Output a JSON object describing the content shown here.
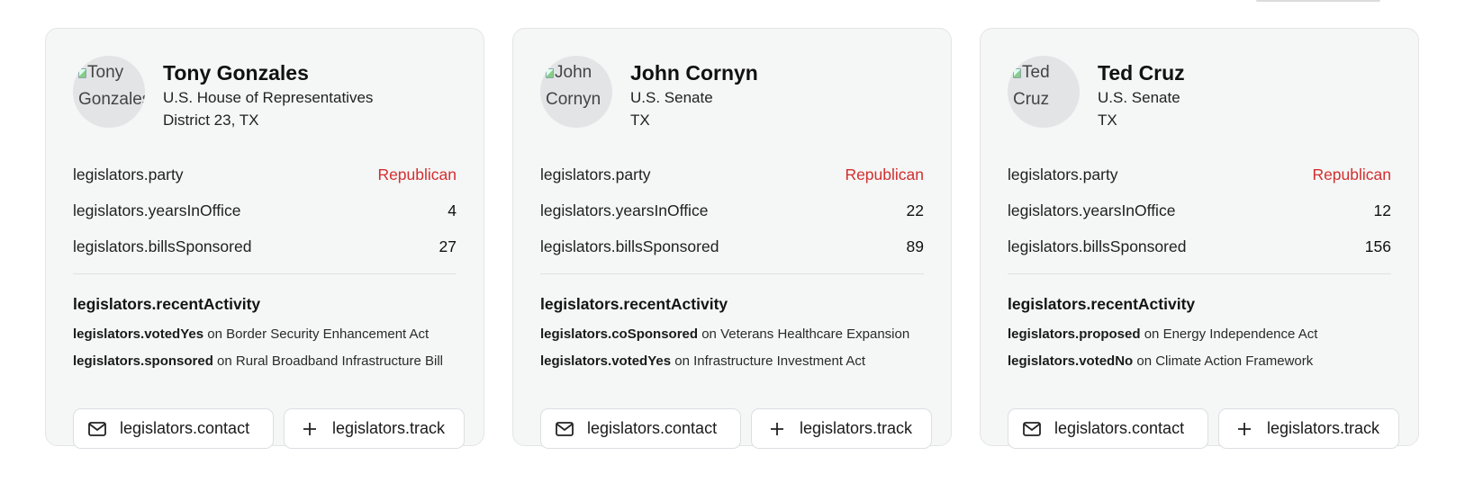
{
  "legislators": [
    {
      "avatar_alt": "Tony\nGonzales",
      "name": "Tony Gonzales",
      "chamber": "U.S. House of Representatives",
      "district": "District 23, TX",
      "stats": [
        {
          "label": "legislators.party",
          "value": "Republican"
        },
        {
          "label": "legislators.yearsInOffice",
          "value": "4"
        },
        {
          "label": "legislators.billsSponsored",
          "value": "27"
        }
      ],
      "recent_activity_title": "legislators.recentActivity",
      "activity": [
        {
          "verb": "legislators.votedYes",
          "text": " on Border Security Enhancement Act"
        },
        {
          "verb": "legislators.sponsored",
          "text": " on Rural Broadband Infrastructure Bill"
        }
      ],
      "contact_label": "legislators.contact",
      "track_label": "legislators.track"
    },
    {
      "avatar_alt": "John\nCornyn",
      "name": "John Cornyn",
      "chamber": "U.S. Senate",
      "district": "TX",
      "stats": [
        {
          "label": "legislators.party",
          "value": "Republican"
        },
        {
          "label": "legislators.yearsInOffice",
          "value": "22"
        },
        {
          "label": "legislators.billsSponsored",
          "value": "89"
        }
      ],
      "recent_activity_title": "legislators.recentActivity",
      "activity": [
        {
          "verb": "legislators.coSponsored",
          "text": " on Veterans Healthcare Expansion"
        },
        {
          "verb": "legislators.votedYes",
          "text": " on Infrastructure Investment Act"
        }
      ],
      "contact_label": "legislators.contact",
      "track_label": "legislators.track"
    },
    {
      "avatar_alt": "Ted\nCruz",
      "name": "Ted Cruz",
      "chamber": "U.S. Senate",
      "district": "TX",
      "stats": [
        {
          "label": "legislators.party",
          "value": "Republican"
        },
        {
          "label": "legislators.yearsInOffice",
          "value": "12"
        },
        {
          "label": "legislators.billsSponsored",
          "value": "156"
        }
      ],
      "recent_activity_title": "legislators.recentActivity",
      "activity": [
        {
          "verb": "legislators.proposed",
          "text": " on Energy Independence Act"
        },
        {
          "verb": "legislators.votedNo",
          "text": " on Climate Action Framework"
        }
      ],
      "contact_label": "legislators.contact",
      "track_label": "legislators.track"
    }
  ],
  "colors": {
    "party_republican": "#d32f2f",
    "card_bg": "#f5f6f6"
  },
  "icons": {
    "contact": "mail-icon",
    "track": "plus-icon"
  }
}
